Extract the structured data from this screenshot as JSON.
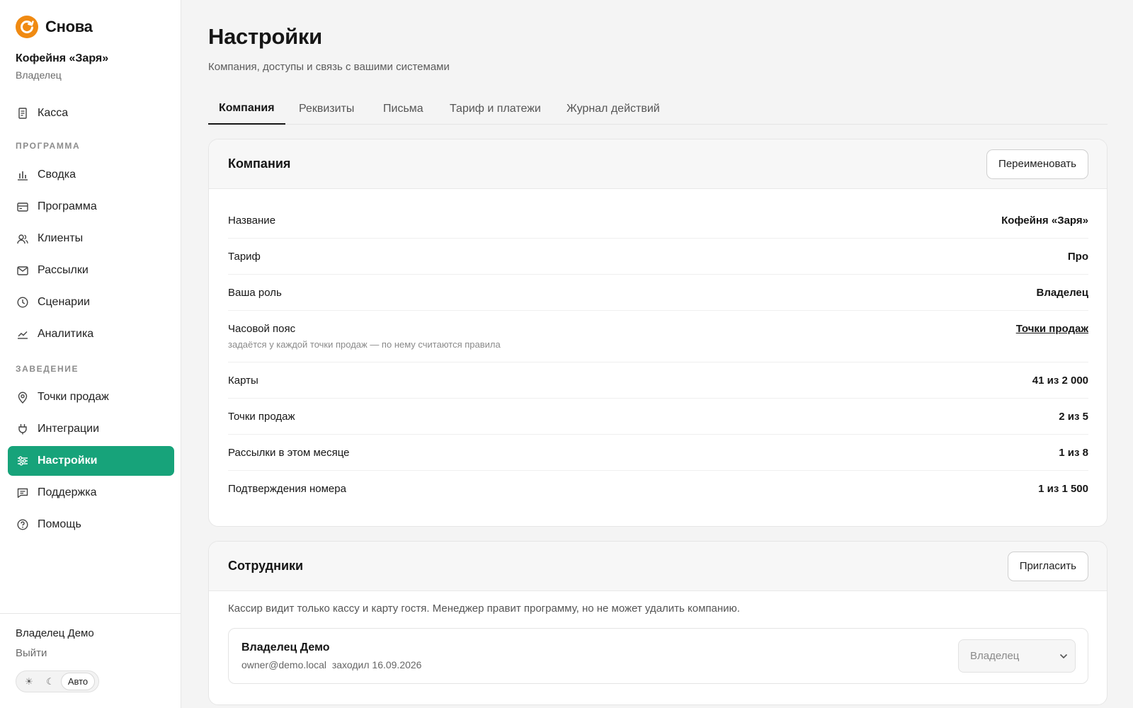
{
  "brand": {
    "name": "Снова",
    "accent": "#f08a12",
    "active_color": "#17a37a"
  },
  "org": {
    "name": "Кофейня «Заря»",
    "role": "Владелец"
  },
  "nav": {
    "top": [
      {
        "label": "Касса",
        "icon": "receipt-icon"
      }
    ],
    "section_program": "ПРОГРАММА",
    "program": [
      {
        "label": "Сводка",
        "icon": "bar-chart-icon"
      },
      {
        "label": "Программа",
        "icon": "card-icon"
      },
      {
        "label": "Клиенты",
        "icon": "users-icon"
      },
      {
        "label": "Рассылки",
        "icon": "mail-icon"
      },
      {
        "label": "Сценарии",
        "icon": "clock-icon"
      },
      {
        "label": "Аналитика",
        "icon": "trend-icon"
      }
    ],
    "section_venue": "ЗАВЕДЕНИЕ",
    "venue": [
      {
        "label": "Точки продаж",
        "icon": "map-pin-icon"
      },
      {
        "label": "Интеграции",
        "icon": "plug-icon"
      },
      {
        "label": "Настройки",
        "icon": "sliders-icon",
        "active": true
      },
      {
        "label": "Поддержка",
        "icon": "chat-icon"
      },
      {
        "label": "Помощь",
        "icon": "help-icon"
      }
    ]
  },
  "footer": {
    "user": "Владелец Демо",
    "logout": "Выйти",
    "theme": {
      "light": "☀",
      "dark": "☾",
      "auto": "Авто",
      "selected": "Авто"
    }
  },
  "page": {
    "title": "Настройки",
    "subtitle": "Компания, доступы и связь с вашими системами",
    "tabs": [
      "Компания",
      "Реквизиты",
      "Письма",
      "Тариф и платежи",
      "Журнал действий"
    ],
    "active_tab": "Компания"
  },
  "company_card": {
    "title": "Компания",
    "action": "Переименовать",
    "rows": [
      {
        "label": "Название",
        "value": "Кофейня «Заря»"
      },
      {
        "label": "Тариф",
        "value": "Про"
      },
      {
        "label": "Ваша роль",
        "value": "Владелец"
      },
      {
        "label": "Часовой пояс",
        "hint": "задаётся у каждой точки продаж — по нему считаются правила",
        "value": "Точки продаж"
      },
      {
        "label": "Карты",
        "value": "41 из 2 000"
      },
      {
        "label": "Точки продаж",
        "value": "2 из 5"
      },
      {
        "label": "Рассылки в этом месяце",
        "value": "1 из 8"
      },
      {
        "label": "Подтверждения номера",
        "value": "1 из 1 500"
      }
    ]
  },
  "staff_card": {
    "title": "Сотрудники",
    "action": "Пригласить",
    "note": "Кассир видит только кассу и карту гостя. Менеджер правит программу, но не может удалить компанию.",
    "members": [
      {
        "name": "Владелец Демо",
        "email": "owner@demo.local",
        "last_seen": "заходил 16.09.2026",
        "role": "Владелец"
      }
    ]
  }
}
